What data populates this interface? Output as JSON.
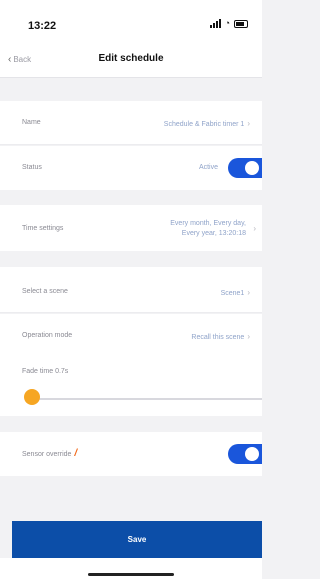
{
  "status_bar": {
    "time": "13:22"
  },
  "nav": {
    "back_label": "Back",
    "title": "Edit schedule"
  },
  "fields": {
    "name": {
      "label": "Name",
      "value": "Schedule & Fabric timer 1"
    },
    "status": {
      "label": "Status",
      "value": "Active",
      "toggle_on": true
    },
    "time_settings": {
      "label": "Time settings",
      "value_line1": "Every month, Every day,",
      "value_line2": "Every year, 13:20:18"
    },
    "scene": {
      "label": "Select a scene",
      "value": "Scene1"
    },
    "operation_mode": {
      "label": "Operation mode",
      "value": "Recall this scene"
    },
    "fade_time": {
      "label": "Fade time",
      "value": "0.7s",
      "slider_fraction": 0.0
    },
    "sensor_override": {
      "label": "Sensor override",
      "toggle_on": true
    }
  },
  "footer": {
    "save_label": "Save"
  },
  "colors": {
    "accent": "#1a56db",
    "save_button": "#0c4ea8",
    "slider_knob": "#f6a623",
    "warning": "#f26b1d"
  },
  "icons": {
    "back": "chevron-left-icon",
    "row_chevron": "chevron-right-icon",
    "warning": "warning-icon"
  }
}
